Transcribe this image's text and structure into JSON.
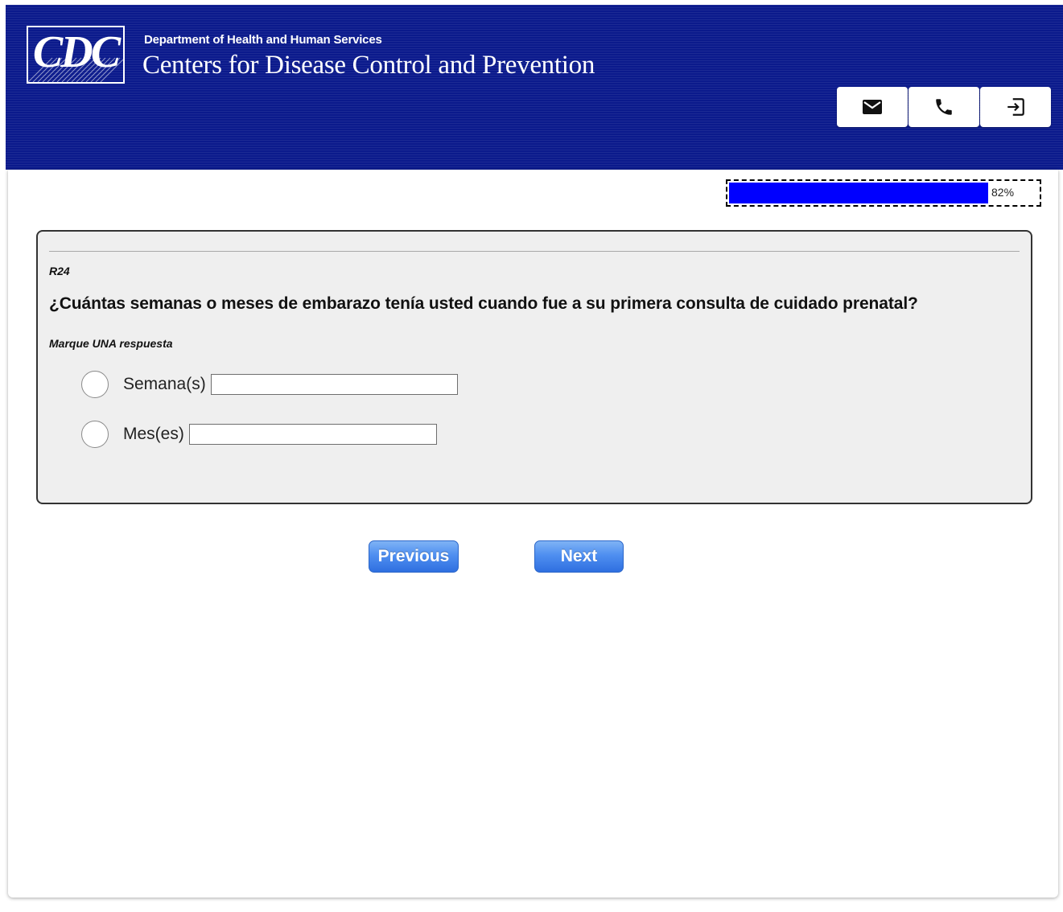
{
  "header": {
    "logo_text": "CDC",
    "department": "Department of Health and Human Services",
    "agency": "Centers for Disease Control and Prevention",
    "buttons": [
      {
        "icon": "mail-icon"
      },
      {
        "icon": "phone-icon"
      },
      {
        "icon": "logout-icon"
      }
    ],
    "background_color": "#0b1a8c"
  },
  "progress": {
    "percent": 82,
    "label": "82%",
    "fill_color": "#0000ff"
  },
  "question": {
    "id": "R24",
    "text": "¿Cuántas semanas o meses de embarazo tenía usted cuando fue a su primera consulta de cuidado prenatal?",
    "instruction": "Marque UNA respuesta",
    "options": [
      {
        "label": "Semana(s)",
        "value": "",
        "selected": false
      },
      {
        "label": "Mes(es)",
        "value": "",
        "selected": false
      }
    ]
  },
  "navigation": {
    "previous_label": "Previous",
    "next_label": "Next"
  }
}
